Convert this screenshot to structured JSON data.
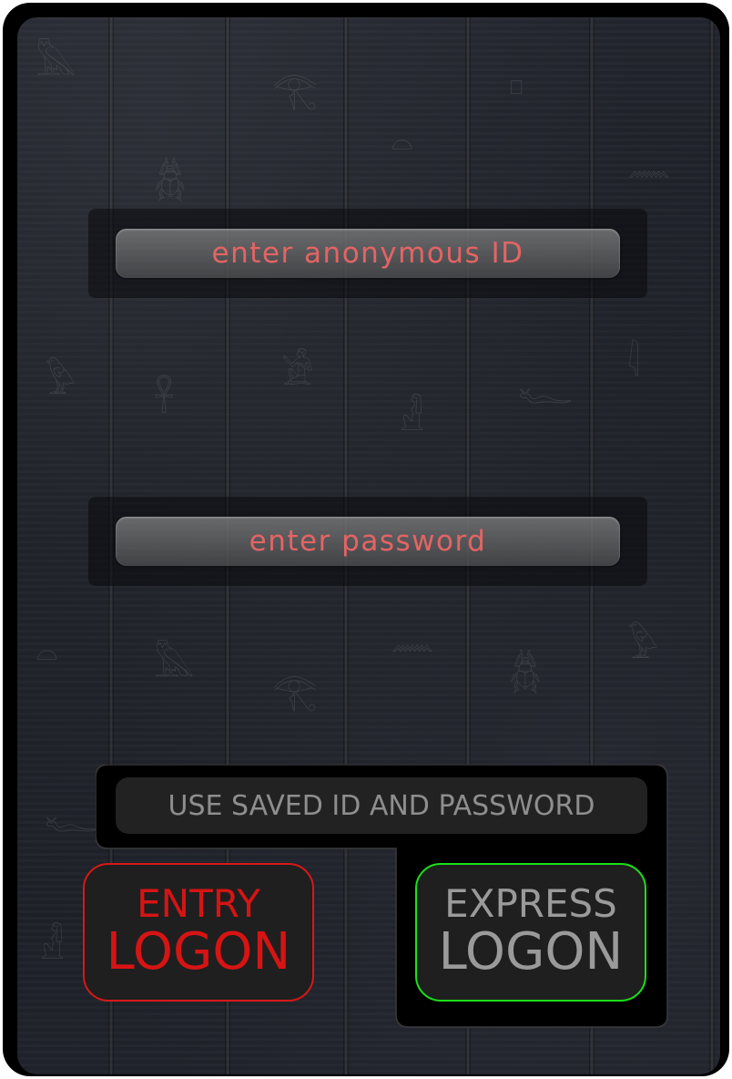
{
  "login": {
    "id_placeholder": "enter anonymous ID",
    "password_placeholder": "enter password",
    "saved_button_label": "USE SAVED ID AND PASSWORD",
    "entry_logon": {
      "line1": "ENTRY",
      "line2": "LOGON",
      "border_color": "#d81818",
      "text_color": "#d61414"
    },
    "express_logon": {
      "line1": "EXPRESS",
      "line2": "LOGON",
      "border_color": "#19e019",
      "text_color": "#9a9a9a"
    }
  },
  "background": {
    "description_icon": "hieroglyph-stone-texture",
    "glyphs": [
      "𓅓",
      "𓆣",
      "𓂀",
      "𓏏",
      "𓊪",
      "𓈖",
      "𓅱",
      "𓋹",
      "𓀀",
      "𓁐",
      "𓆑",
      "𓇋"
    ]
  }
}
